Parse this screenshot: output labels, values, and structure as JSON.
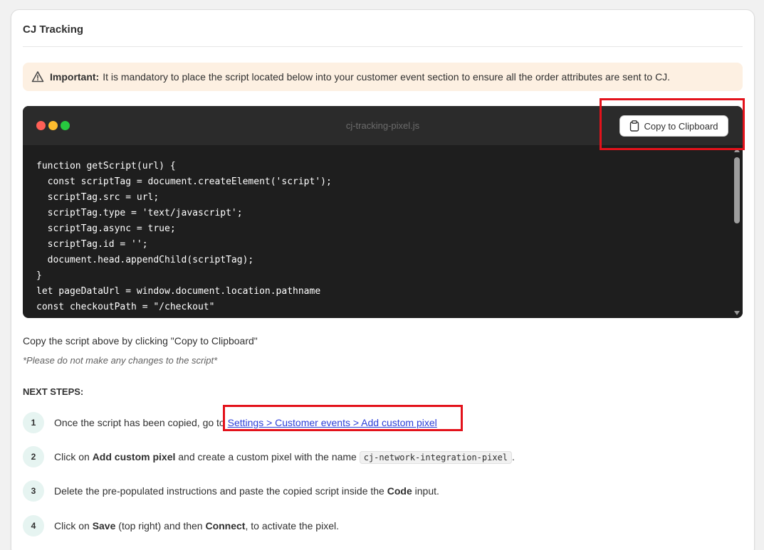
{
  "card": {
    "title": "CJ Tracking"
  },
  "banner": {
    "icon": "warning-icon",
    "label": "Important:",
    "text": "It is mandatory to place the script located below into your customer event section to ensure all the order attributes are sent to CJ."
  },
  "code_window": {
    "filename": "cj-tracking-pixel.js",
    "copy_label": "Copy to Clipboard",
    "copy_icon": "clipboard-icon",
    "lines": [
      "function getScript(url) {",
      "  const scriptTag = document.createElement('script');",
      "  scriptTag.src = url;",
      "  scriptTag.type = 'text/javascript';",
      "  scriptTag.async = true;",
      "  scriptTag.id = '';",
      "  document.head.appendChild(scriptTag);",
      "}",
      "let pageDataUrl = window.document.location.pathname",
      "const checkoutPath = \"/checkout\""
    ]
  },
  "instructions": "Copy the script above by clicking \"Copy to Clipboard\"",
  "note": "*Please do not make any changes to the script*",
  "next_steps": {
    "title": "NEXT STEPS:",
    "steps": [
      {
        "num": "1",
        "before": "Once the script has been copied, go to ",
        "link": "Settings > Customer events > Add custom pixel"
      },
      {
        "num": "2",
        "before": "Click on ",
        "bold": "Add custom pixel",
        "middle": " and create a custom pixel with the name ",
        "code": "cj-network-integration-pixel",
        "after": "."
      },
      {
        "num": "3",
        "before": "Delete the pre-populated instructions and paste the copied script inside the ",
        "bold": "Code",
        "after": " input."
      },
      {
        "num": "4",
        "before": "Click on ",
        "bold": "Save",
        "middle": " (top right) and then ",
        "bold2": "Connect",
        "after": ", to activate the pixel."
      }
    ]
  },
  "colors": {
    "highlight": "#e3121b",
    "link": "#2c3fd8",
    "banner_bg": "#fdf0e2",
    "code_bg": "#1e1e1e"
  }
}
